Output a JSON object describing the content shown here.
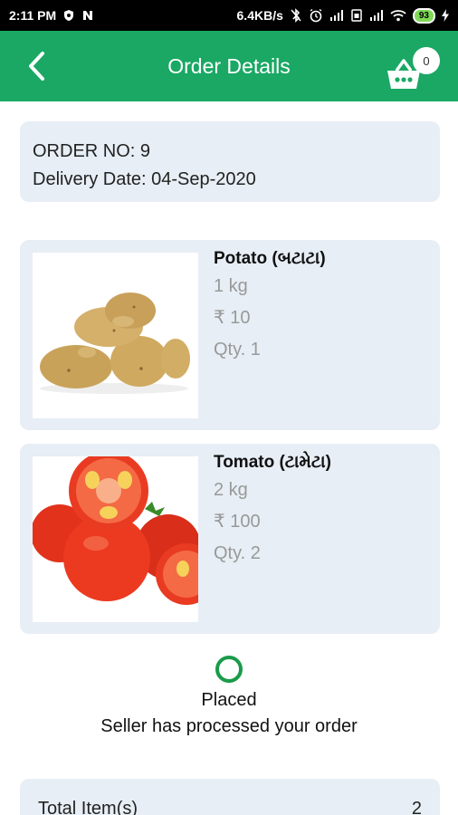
{
  "status_bar": {
    "time": "2:11 PM",
    "net_speed": "6.4KB/s",
    "battery": "93"
  },
  "app_bar": {
    "title": "Order Details",
    "cart_count": "0"
  },
  "order": {
    "order_no": "ORDER NO: 9",
    "delivery_date": "Delivery Date: 04-Sep-2020"
  },
  "items": [
    {
      "name": "Potato (બટાટા)",
      "unit": "1 kg",
      "price": "₹ 10",
      "qty": "Qty. 1"
    },
    {
      "name": "Tomato (ટામેટા)",
      "unit": "2 kg",
      "price": "₹ 100",
      "qty": "Qty. 2"
    }
  ],
  "status": {
    "label": "Placed",
    "description": "Seller has processed your order"
  },
  "summary": {
    "total_items_label": "Total Item(s)",
    "total_items_value": "2"
  },
  "colors": {
    "primary": "#1aa864",
    "card_bg": "#e7eef5",
    "status_ring": "#1a9b4a"
  }
}
